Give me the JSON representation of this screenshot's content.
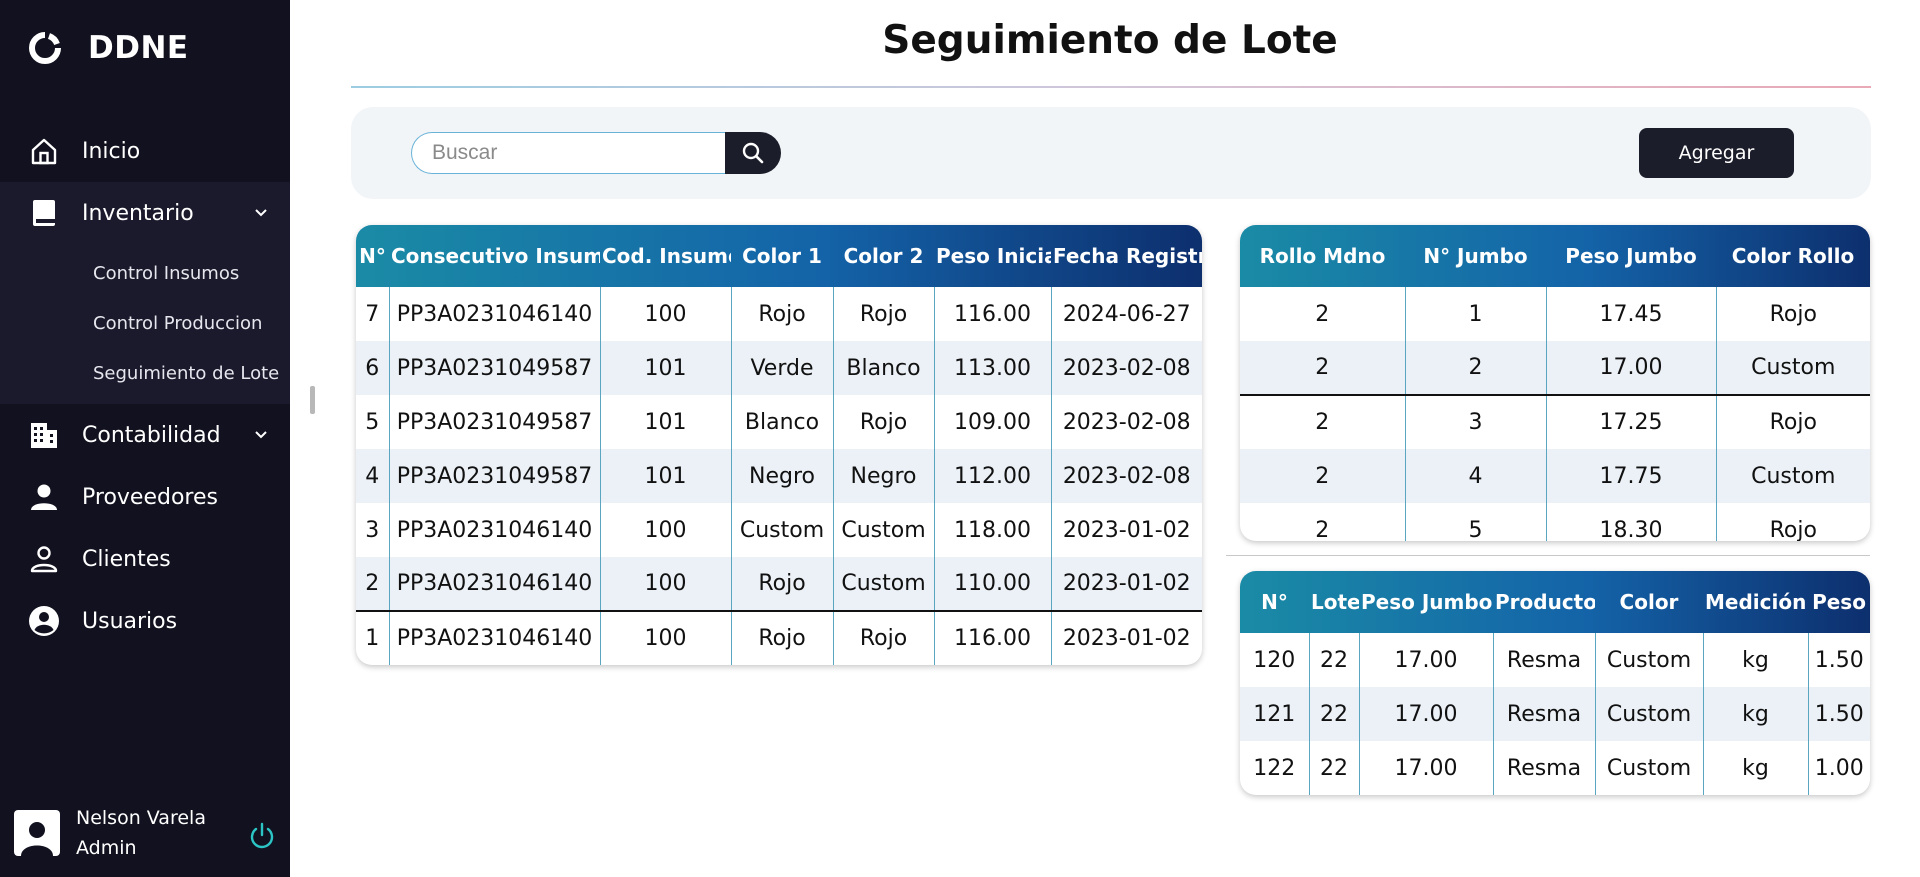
{
  "app": {
    "brand": "DDNE",
    "page_title": "Seguimiento de Lote"
  },
  "sidebar": {
    "items": [
      {
        "label": "Inicio",
        "icon": "home-icon"
      },
      {
        "label": "Inventario",
        "icon": "book-icon",
        "expanded": true,
        "children": [
          "Control Insumos",
          "Control Produccion",
          "Seguimiento de Lote"
        ]
      },
      {
        "label": "Contabilidad",
        "icon": "building-icon",
        "expanded": false
      },
      {
        "label": "Proveedores",
        "icon": "person-icon"
      },
      {
        "label": "Clientes",
        "icon": "person-outline-icon"
      },
      {
        "label": "Usuarios",
        "icon": "user-circle-icon"
      }
    ],
    "user": {
      "name": "Nelson Varela",
      "role": "Admin"
    }
  },
  "toolbar": {
    "search_placeholder": "Buscar",
    "add_label": "Agregar"
  },
  "colors": {
    "sidebar_bg": "#11111f",
    "header_gradient_start": "#1a8ba6",
    "header_gradient_end": "#0d2f6e",
    "button_dark": "#1c1d2a",
    "power_icon": "#2cc5c5"
  },
  "lotes_table": {
    "headers": [
      "N°",
      "Consecutivo Insumo",
      "Cod. Insumo",
      "Color 1",
      "Color 2",
      "Peso Inicial",
      "Fecha Registro"
    ],
    "rows": [
      [
        "7",
        "PP3A0231046140",
        "100",
        "Rojo",
        "Rojo",
        "116.00",
        "2024-06-27"
      ],
      [
        "6",
        "PP3A0231049587",
        "101",
        "Verde",
        "Blanco",
        "113.00",
        "2023-02-08"
      ],
      [
        "5",
        "PP3A0231049587",
        "101",
        "Blanco",
        "Rojo",
        "109.00",
        "2023-02-08"
      ],
      [
        "4",
        "PP3A0231049587",
        "101",
        "Negro",
        "Negro",
        "112.00",
        "2023-02-08"
      ],
      [
        "3",
        "PP3A0231046140",
        "100",
        "Custom",
        "Custom",
        "118.00",
        "2023-01-02"
      ],
      [
        "2",
        "PP3A0231046140",
        "100",
        "Rojo",
        "Custom",
        "110.00",
        "2023-01-02"
      ],
      [
        "1",
        "PP3A0231046140",
        "100",
        "Rojo",
        "Rojo",
        "116.00",
        "2023-01-02"
      ]
    ],
    "selected_row": 5
  },
  "jumbos_table": {
    "headers": [
      "Rollo Mdno",
      "N° Jumbo",
      "Peso Jumbo",
      "Color Rollo"
    ],
    "rows": [
      [
        "2",
        "1",
        "17.45",
        "Rojo"
      ],
      [
        "2",
        "2",
        "17.00",
        "Custom"
      ],
      [
        "2",
        "3",
        "17.25",
        "Rojo"
      ],
      [
        "2",
        "4",
        "17.75",
        "Custom"
      ],
      [
        "2",
        "5",
        "18.30",
        "Rojo"
      ]
    ],
    "selected_row": 1
  },
  "productos_table": {
    "headers": [
      "N°",
      "Lote",
      "Peso Jumbo",
      "Producto",
      "Color",
      "Medición",
      "Peso"
    ],
    "rows": [
      [
        "120",
        "22",
        "17.00",
        "Resma",
        "Custom",
        "kg",
        "1.50"
      ],
      [
        "121",
        "22",
        "17.00",
        "Resma",
        "Custom",
        "kg",
        "1.50"
      ],
      [
        "122",
        "22",
        "17.00",
        "Resma",
        "Custom",
        "kg",
        "1.00"
      ]
    ]
  }
}
